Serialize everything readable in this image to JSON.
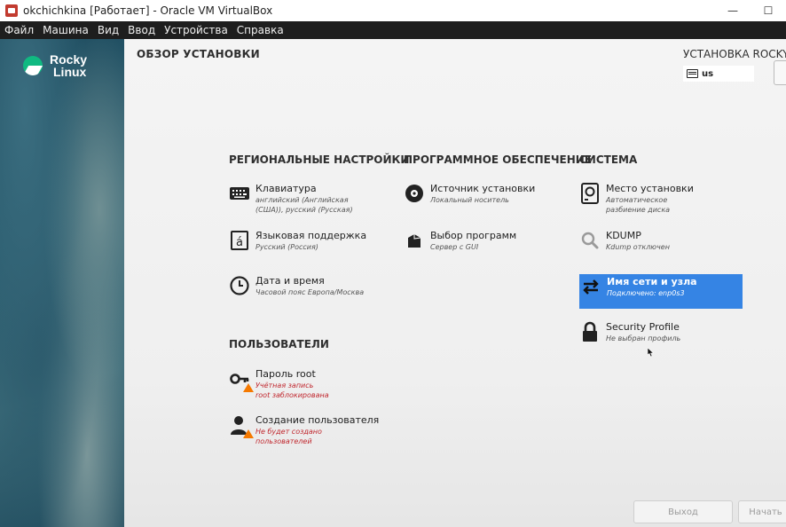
{
  "window": {
    "title": "okchichkina [Работает] - Oracle VM VirtualBox",
    "controls": {
      "minimize": "—",
      "maximize": "☐"
    }
  },
  "menubar": {
    "items": [
      "Файл",
      "Машина",
      "Вид",
      "Ввод",
      "Устройства",
      "Справка"
    ]
  },
  "sidebar": {
    "logo_line1": "Rocky",
    "logo_line2": "Linux"
  },
  "header": {
    "page_title": "ОБЗОР УСТАНОВКИ",
    "install_title": "УСТАНОВКА ROCKY L",
    "keyboard_layout": "us"
  },
  "categories": {
    "regional": "РЕГИОНАЛЬНЫЕ НАСТРОЙКИ",
    "software": "ПРОГРАММНОЕ ОБЕСПЕЧЕНИЕ",
    "system": "СИСТЕМА",
    "users": "ПОЛЬЗОВАТЕЛИ"
  },
  "spokes": {
    "keyboard": {
      "name": "Клавиатура",
      "status1": "английский (Английская",
      "status2": "(США)), русский (Русская)",
      "icon": "keyboard-icon"
    },
    "language": {
      "name": "Языковая поддержка",
      "status1": "Русский (Россия)",
      "icon": "language-icon"
    },
    "datetime": {
      "name": "Дата и время",
      "status1": "Часовой пояс Европа/Москва",
      "icon": "clock-icon"
    },
    "source": {
      "name": "Источник установки",
      "status1": "Локальный носитель",
      "icon": "disc-icon"
    },
    "software": {
      "name": "Выбор программ",
      "status1": "Сервер с GUI",
      "icon": "package-icon"
    },
    "destination": {
      "name": "Место установки",
      "status1": "Автоматическое",
      "status2": "разбиение диска",
      "icon": "harddisk-icon"
    },
    "kdump": {
      "name": "KDUMP",
      "status1": "Kdump отключен",
      "icon": "search-icon"
    },
    "network": {
      "name": "Имя сети и узла",
      "status1": "Подключено: enp0s3",
      "icon": "network-icon",
      "selected": true
    },
    "security": {
      "name": "Security Profile",
      "status1": "Не выбран профиль",
      "icon": "lock-icon"
    },
    "root": {
      "name": "Пароль root",
      "status1": "Учётная запись",
      "status2": "root заблокирована",
      "icon": "key-icon",
      "warning": true
    },
    "user": {
      "name": "Создание пользователя",
      "status1": "Не будет создано",
      "status2": "пользователей",
      "icon": "user-icon",
      "warning": true
    }
  },
  "buttons": {
    "quit": "Выход",
    "begin": "Начать"
  },
  "colors": {
    "accent": "#3584e4",
    "warning_text": "#c0262d",
    "warning_badge": "#f57900"
  }
}
